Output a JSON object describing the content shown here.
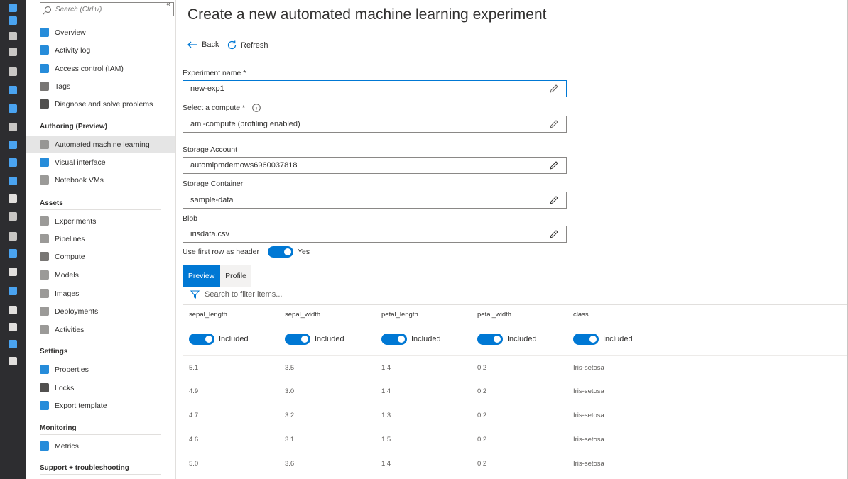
{
  "rail": {
    "icons": [
      {
        "name": "home-icon",
        "color": "#4aa3f0"
      },
      {
        "name": "dashboard-icon",
        "color": "#4aa3f0"
      },
      {
        "name": "all-services-icon",
        "color": "#c8c6c4"
      },
      {
        "name": "favorites-star-icon",
        "color": "#c8c6c4"
      },
      {
        "name": "all-resources-icon",
        "color": "#c8c6c4"
      },
      {
        "name": "resource-groups-icon",
        "color": "#4aa3f0"
      },
      {
        "name": "app-services-icon",
        "color": "#4aa3f0"
      },
      {
        "name": "function-apps-icon",
        "color": "#c8c6c4"
      },
      {
        "name": "sql-databases-icon",
        "color": "#4aa3f0"
      },
      {
        "name": "cosmos-db-icon",
        "color": "#4aa3f0"
      },
      {
        "name": "virtual-machines-icon",
        "color": "#4aa3f0"
      },
      {
        "name": "load-balancers-icon",
        "color": "#e1dfdd"
      },
      {
        "name": "storage-accounts-icon",
        "color": "#c8c6c4"
      },
      {
        "name": "virtual-networks-icon",
        "color": "#c8c6c4"
      },
      {
        "name": "azure-ad-icon",
        "color": "#4aa3f0"
      },
      {
        "name": "monitor-icon",
        "color": "#e1dfdd"
      },
      {
        "name": "advisor-icon",
        "color": "#4aa3f0"
      },
      {
        "name": "security-center-icon",
        "color": "#e1dfdd"
      },
      {
        "name": "cost-management-icon",
        "color": "#e1dfdd"
      },
      {
        "name": "help-support-icon",
        "color": "#4aa3f0"
      },
      {
        "name": "key-icon",
        "color": "#e1dfdd"
      }
    ]
  },
  "sidebar": {
    "search_placeholder": "Search (Ctrl+/)",
    "collapse_glyph": "«",
    "items": [
      {
        "label": "Overview",
        "icon": "overview-icon",
        "color": "#0078d4"
      },
      {
        "label": "Activity log",
        "icon": "activity-log-icon",
        "color": "#0078d4"
      },
      {
        "label": "Access control (IAM)",
        "icon": "access-control-icon",
        "color": "#0078d4"
      },
      {
        "label": "Tags",
        "icon": "tag-icon",
        "color": "#605e5c"
      },
      {
        "label": "Diagnose and solve problems",
        "icon": "diagnose-wrench-icon",
        "color": "#323130"
      }
    ],
    "authoring": {
      "title": "Authoring (Preview)",
      "items": [
        {
          "label": "Automated machine learning",
          "icon": "automl-icon",
          "color": "#8a8886",
          "active": true
        },
        {
          "label": "Visual interface",
          "icon": "visual-interface-icon",
          "color": "#0078d4"
        },
        {
          "label": "Notebook VMs",
          "icon": "notebook-vm-icon",
          "color": "#8a8886"
        }
      ]
    },
    "assets": {
      "title": "Assets",
      "items": [
        {
          "label": "Experiments",
          "icon": "experiments-icon",
          "color": "#8a8886"
        },
        {
          "label": "Pipelines",
          "icon": "pipelines-icon",
          "color": "#8a8886"
        },
        {
          "label": "Compute",
          "icon": "compute-icon",
          "color": "#605e5c"
        },
        {
          "label": "Models",
          "icon": "models-icon",
          "color": "#8a8886"
        },
        {
          "label": "Images",
          "icon": "images-icon",
          "color": "#8a8886"
        },
        {
          "label": "Deployments",
          "icon": "deployments-icon",
          "color": "#8a8886"
        },
        {
          "label": "Activities",
          "icon": "activities-icon",
          "color": "#8a8886"
        }
      ]
    },
    "settings": {
      "title": "Settings",
      "items": [
        {
          "label": "Properties",
          "icon": "properties-icon",
          "color": "#0078d4"
        },
        {
          "label": "Locks",
          "icon": "lock-icon",
          "color": "#323130"
        },
        {
          "label": "Export template",
          "icon": "export-template-icon",
          "color": "#0078d4"
        }
      ]
    },
    "monitoring": {
      "title": "Monitoring",
      "items": [
        {
          "label": "Metrics",
          "icon": "metrics-icon",
          "color": "#0078d4"
        }
      ]
    },
    "support": {
      "title": "Support + troubleshooting"
    }
  },
  "main": {
    "title": "Create a new automated machine learning experiment",
    "back_label": "Back",
    "refresh_label": "Refresh",
    "experiment_name_label": "Experiment name *",
    "experiment_name_value": "new-exp1",
    "compute_label": "Select a compute *",
    "compute_value": "aml-compute (profiling enabled)",
    "storage_account_label": "Storage Account",
    "storage_account_value": "automlpmdemows6960037818",
    "storage_container_label": "Storage Container",
    "storage_container_value": "sample-data",
    "blob_label": "Blob",
    "blob_value": "irisdata.csv",
    "header_row_label": "Use first row as header",
    "header_row_value": "Yes",
    "tabs": {
      "preview": "Preview",
      "profile": "Profile"
    },
    "filter_placeholder": "Search to filter items...",
    "accent": "#0078d4"
  },
  "grid": {
    "columns": [
      {
        "name": "sepal_length",
        "status": "Included"
      },
      {
        "name": "sepal_width",
        "status": "Included"
      },
      {
        "name": "petal_length",
        "status": "Included"
      },
      {
        "name": "petal_width",
        "status": "Included"
      },
      {
        "name": "class",
        "status": "Included"
      }
    ],
    "rows": [
      [
        "5.1",
        "3.5",
        "1.4",
        "0.2",
        "Iris-setosa"
      ],
      [
        "4.9",
        "3.0",
        "1.4",
        "0.2",
        "Iris-setosa"
      ],
      [
        "4.7",
        "3.2",
        "1.3",
        "0.2",
        "Iris-setosa"
      ],
      [
        "4.6",
        "3.1",
        "1.5",
        "0.2",
        "Iris-setosa"
      ],
      [
        "5.0",
        "3.6",
        "1.4",
        "0.2",
        "Iris-setosa"
      ]
    ]
  }
}
